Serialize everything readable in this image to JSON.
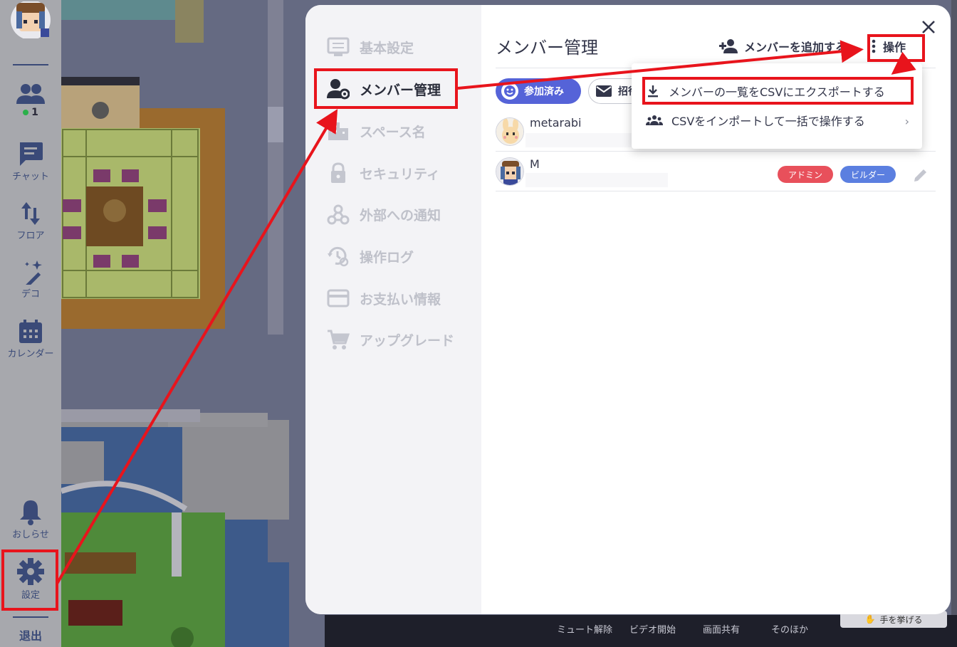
{
  "sidebar": {
    "online_count": "1",
    "items": [
      {
        "label": "チャット"
      },
      {
        "label": "フロア"
      },
      {
        "label": "デコ"
      },
      {
        "label": "カレンダー"
      },
      {
        "label": "おしらせ"
      },
      {
        "label": "設定"
      }
    ],
    "exit_label": "退出"
  },
  "settings_nav": {
    "items": [
      {
        "label": "基本設定",
        "icon": "settings-panel-icon"
      },
      {
        "label": "メンバー管理",
        "icon": "member-settings-icon",
        "active": true
      },
      {
        "label": "スペース名",
        "icon": "building-icon"
      },
      {
        "label": "セキュリティ",
        "icon": "lock-icon"
      },
      {
        "label": "外部への通知",
        "icon": "webhook-icon"
      },
      {
        "label": "操作ログ",
        "icon": "history-icon"
      },
      {
        "label": "お支払い情報",
        "icon": "credit-card-icon"
      },
      {
        "label": "アップグレード",
        "icon": "cart-icon"
      }
    ]
  },
  "main": {
    "title": "メンバー管理",
    "add_member_label": "メンバーを追加する",
    "ops_label": "操作",
    "filters": {
      "joined": "参加済み",
      "invited": "招待"
    },
    "members": [
      {
        "name": "metarabi",
        "badges": []
      },
      {
        "name": "M",
        "badges": [
          {
            "label": "アドミン",
            "color": "#e8505b"
          },
          {
            "label": "ビルダー",
            "color": "#5b7fe0"
          }
        ]
      }
    ]
  },
  "dropdown": {
    "items": [
      {
        "label": "メンバーの一覧をCSVにエクスポートする",
        "icon": "download-icon"
      },
      {
        "label": "CSVをインポートして一括で操作する",
        "icon": "group-icon"
      }
    ]
  },
  "bottom_bar": {
    "mute": "ミュート解除",
    "video": "ビデオ開始",
    "share": "画面共有",
    "other": "そのほか",
    "raise_hand": "手を挙げる"
  },
  "colors": {
    "accent": "#5563d8",
    "annotation": "#e8141c",
    "admin_badge": "#e8505b",
    "builder_badge": "#5b7fe0"
  }
}
